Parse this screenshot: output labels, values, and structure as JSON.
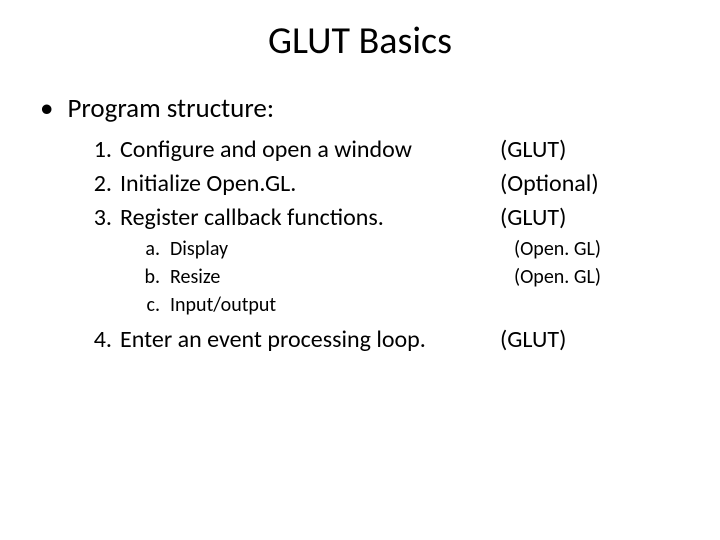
{
  "title": "GLUT Basics",
  "bullet": "Program structure:",
  "items": [
    {
      "n": "1.",
      "text": "Configure and open a window",
      "note": "(GLUT)"
    },
    {
      "n": "2.",
      "text": "Initialize Open.GL.",
      "note": "(Optional)"
    },
    {
      "n": "3.",
      "text": "Register callback functions.",
      "note": "(GLUT)"
    }
  ],
  "subitems": [
    {
      "n": "a.",
      "text": "Display",
      "note": "(Open. GL)"
    },
    {
      "n": "b.",
      "text": "Resize",
      "note": "(Open. GL)"
    },
    {
      "n": "c.",
      "text": "Input/output",
      "note": ""
    }
  ],
  "item4": {
    "n": "4.",
    "text": "Enter an event processing loop.",
    "note": "(GLUT)"
  }
}
